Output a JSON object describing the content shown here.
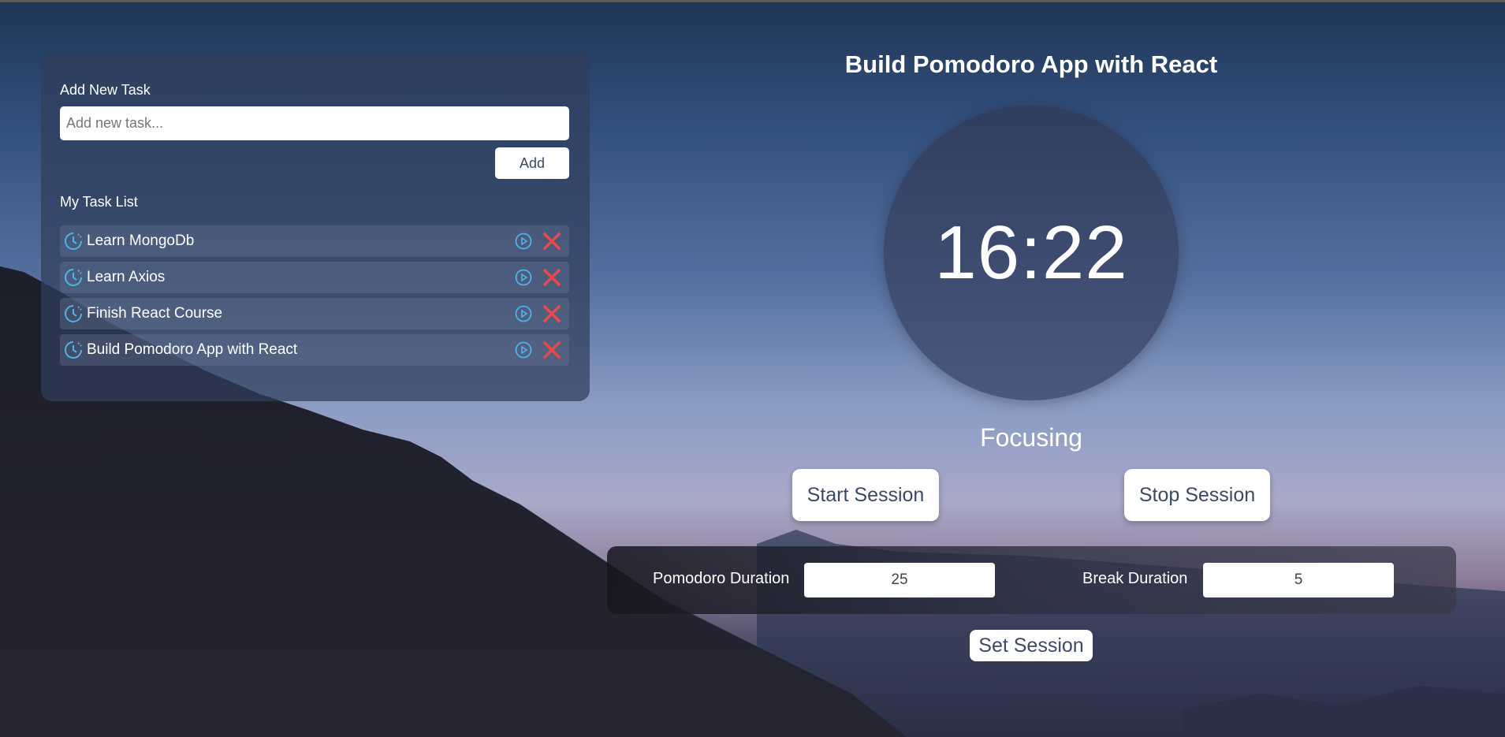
{
  "colors": {
    "accent_icon": "#4fb3e8",
    "delete": "#e84a4a",
    "button_text": "#3d4a66"
  },
  "tasks_panel": {
    "add_heading": "Add New Task",
    "input_placeholder": "Add new task...",
    "input_value": "",
    "add_button_label": "Add",
    "list_heading": "My Task List",
    "items": [
      {
        "label": "Learn MongoDb",
        "icon": "clock-icon"
      },
      {
        "label": "Learn Axios",
        "icon": "clock-icon"
      },
      {
        "label": "Finish React Course",
        "icon": "clock-icon"
      },
      {
        "label": "Build Pomodoro App with React",
        "icon": "clock-icon"
      }
    ]
  },
  "timer": {
    "current_task": "Build Pomodoro App with React",
    "time": "16:22",
    "status": "Focusing",
    "start_label": "Start Session",
    "stop_label": "Stop Session"
  },
  "settings": {
    "pomodoro_label": "Pomodoro Duration",
    "pomodoro_value": "25",
    "break_label": "Break Duration",
    "break_value": "5",
    "set_label": "Set Session"
  }
}
